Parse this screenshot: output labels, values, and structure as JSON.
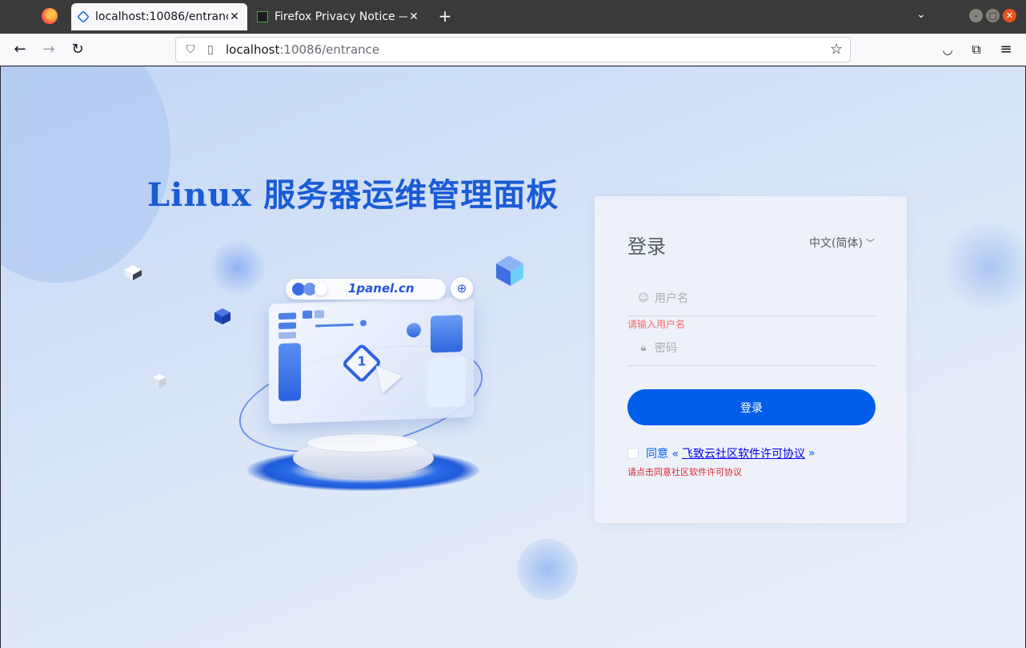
{
  "browser": {
    "tabs": [
      {
        "title": "localhost:10086/entrance",
        "active": true
      },
      {
        "title": "Firefox Privacy Notice —",
        "active": false
      }
    ],
    "url_host": "localhost",
    "url_rest": ":10086/entrance",
    "icons": [
      "firefox-icon",
      "back-icon",
      "forward-icon",
      "reload-icon",
      "shield-icon",
      "page-icon",
      "star-icon",
      "pocket-icon",
      "extensions-icon",
      "menu-icon"
    ]
  },
  "page": {
    "headline": "Linux 服务器运维管理面板",
    "illustration_text": "1panel.cn"
  },
  "login": {
    "title": "登录",
    "language": "中文(简体)",
    "username_placeholder": "用户名",
    "username_error": "请输入用户名",
    "password_placeholder": "密码",
    "button_label": "登录",
    "agree_prefix": "同意 «",
    "agree_link": "飞致云社区软件许可协议",
    "agree_suffix": "»",
    "agree_error": "请点击同意社区软件许可协议"
  },
  "colors": {
    "accent": "#005eeb",
    "headline": "#1a5bd6",
    "error": "#f56c6c"
  }
}
